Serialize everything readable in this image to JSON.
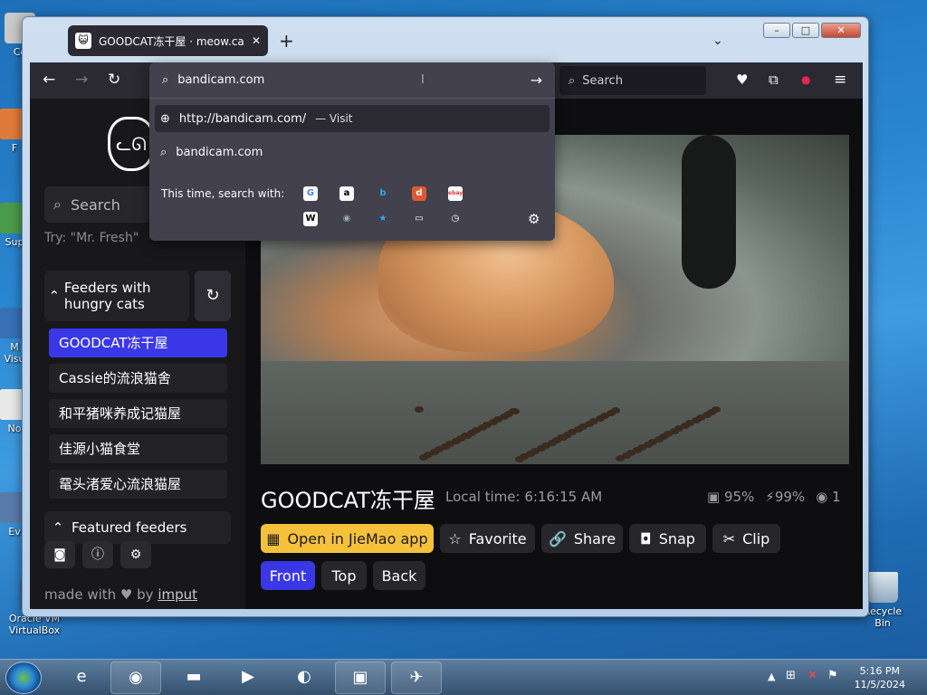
{
  "desktop": {
    "icons": [
      {
        "label": "Co",
        "color": "#c9c9c9"
      },
      {
        "label": "F",
        "color": "#e07a3a"
      },
      {
        "label": "Sup",
        "color": "#4a9a4a"
      },
      {
        "label": "M\nVisu",
        "color": "#3870b8"
      },
      {
        "label": "No",
        "color": "#e8e8e8"
      },
      {
        "label": "Ev",
        "color": "#5a7aaa"
      },
      {
        "label": "Oracle VM\nVirtualBox",
        "color": "#3a6cb0"
      }
    ],
    "recycle_bin": "Recycle Bin"
  },
  "browser": {
    "tab_title": "GOODCAT冻干屋 · meow.camera",
    "tab_close": "✕",
    "new_tab": "+",
    "list_tabs": "⌄",
    "window_min": "–",
    "window_max": "□",
    "window_close": "✕",
    "back": "←",
    "forward": "→",
    "reload": "↻",
    "search_placeholder": "Search",
    "url_value": "bandicam.com",
    "go": "→",
    "suggestions": [
      {
        "text": "http://bandicam.com/",
        "action": "— Visit"
      },
      {
        "text": "bandicam.com",
        "action": ""
      }
    ],
    "search_with": "This time, search with:",
    "engines": [
      {
        "letter": "G",
        "color": "#ffffff",
        "fg": "#4285f4"
      },
      {
        "letter": "a",
        "color": "#f7f7f7",
        "fg": "#000"
      },
      {
        "letter": "b",
        "color": "#42414d",
        "fg": "#2ea6ff"
      },
      {
        "letter": "d",
        "color": "#de5833",
        "fg": "#fff"
      },
      {
        "letter": "ebay",
        "color": "#ffffff",
        "fg": "#e53238"
      },
      {
        "letter": "W",
        "color": "#ffffff",
        "fg": "#000"
      },
      {
        "letter": "◉",
        "color": "#42414d",
        "fg": "#9aa"
      },
      {
        "letter": "★",
        "color": "#42414d",
        "fg": "#2ea6ff"
      },
      {
        "letter": "▭",
        "color": "#42414d",
        "fg": "#fff"
      },
      {
        "letter": "◷",
        "color": "#42414d",
        "fg": "#fff"
      }
    ],
    "settings": "⚙"
  },
  "sidebar": {
    "search_placeholder": "Search",
    "try_hint": "Try: \"Mr. Fresh\"",
    "group_title": "Feeders with hungry cats",
    "feeders": [
      "GOODCAT冻干屋",
      "Cassie的流浪猫舍",
      "和平猪咪养成记猫屋",
      "佳源小猫食堂",
      "鼋头渚爱心流浪猫屋"
    ],
    "featured": "Featured feeders",
    "made_with": "made with ♥ by",
    "made_by": "imput"
  },
  "stream": {
    "title": "GOODCAT冻干屋",
    "local_time": "Local time: 6:16:15 AM",
    "food": "95%",
    "battery": "99%",
    "viewers": "1",
    "buttons": {
      "open": "Open in JieMao app",
      "favorite": "Favorite",
      "share": "Share",
      "snap": "Snap",
      "clip": "Clip"
    },
    "views": [
      "Front",
      "Top",
      "Back"
    ]
  },
  "taskbar": {
    "time": "5:16 PM",
    "date": "11/5/2024"
  }
}
